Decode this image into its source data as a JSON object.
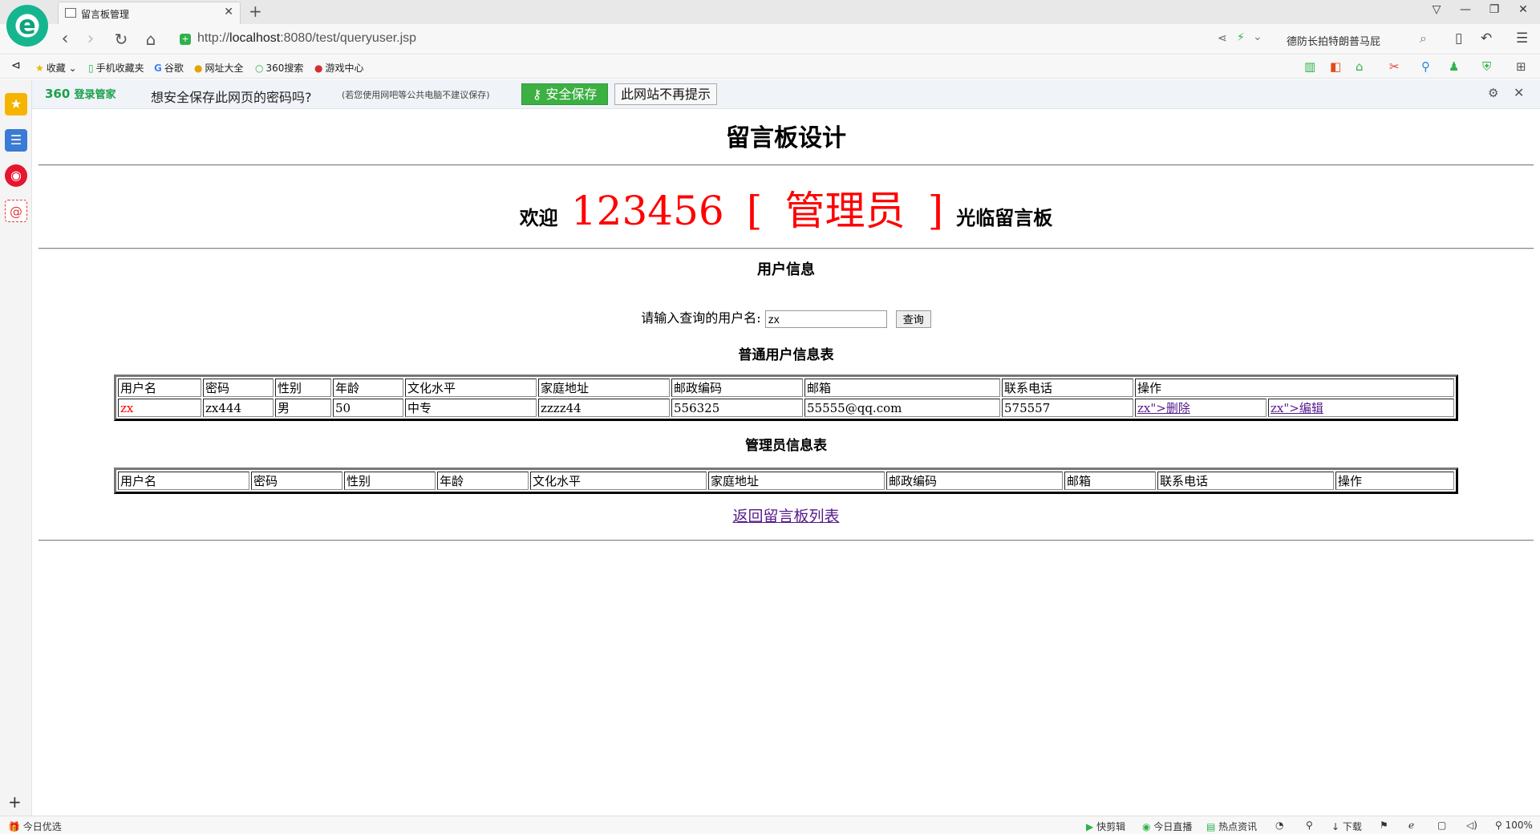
{
  "browser": {
    "tab_title": "留言板管理",
    "url_prefix": "http://",
    "url_host": "localhost",
    "url_rest": ":8080/test/queryuser.jsp",
    "search_text": "德防长拍特朗普马屁",
    "bookmarks": [
      "收藏",
      "手机收藏夹",
      "谷歌",
      "网址大全",
      "360搜索",
      "游戏中心"
    ]
  },
  "password_bar": {
    "brand": "360",
    "brand_sub": "登录管家",
    "question": "想安全保存此网页的密码吗?",
    "note": "(若您使用网吧等公共电脑不建议保存)",
    "save_label": "安全保存",
    "never_label": "此网站不再提示"
  },
  "status_bar": {
    "left": "今日优选",
    "items": [
      "快剪辑",
      "今日直播",
      "热点资讯",
      "下载",
      "100%"
    ]
  },
  "page": {
    "title": "留言板设计",
    "welcome_prefix": "欢迎",
    "user_id": "123456",
    "bracket_open": "[",
    "role": "管理员",
    "bracket_close": "]",
    "welcome_suffix": "光临留言板",
    "section_title": "用户信息",
    "query_label": "请输入查询的用户名:",
    "query_value": "zx",
    "query_button": "查询",
    "normal_table_title": "普通用户信息表",
    "admin_table_title": "管理员信息表",
    "back_link": "返回留言板列表"
  },
  "normal_table": {
    "headers": [
      "用户名",
      "密码",
      "性别",
      "年龄",
      "文化水平",
      "家庭地址",
      "邮政编码",
      "邮箱",
      "联系电话",
      "操作"
    ],
    "row": {
      "username": "zx",
      "password": "zx444",
      "gender": "男",
      "age": "50",
      "education": "中专",
      "address": "zzzz44",
      "postcode": "556325",
      "email": "55555@qq.com",
      "phone": "575557",
      "delete_link": "zx\">删除",
      "edit_link": "zx\">编辑"
    }
  },
  "admin_table": {
    "headers": [
      "用户名",
      "密码",
      "性别",
      "年龄",
      "文化水平",
      "家庭地址",
      "邮政编码",
      "邮箱",
      "联系电话",
      "操作"
    ]
  }
}
